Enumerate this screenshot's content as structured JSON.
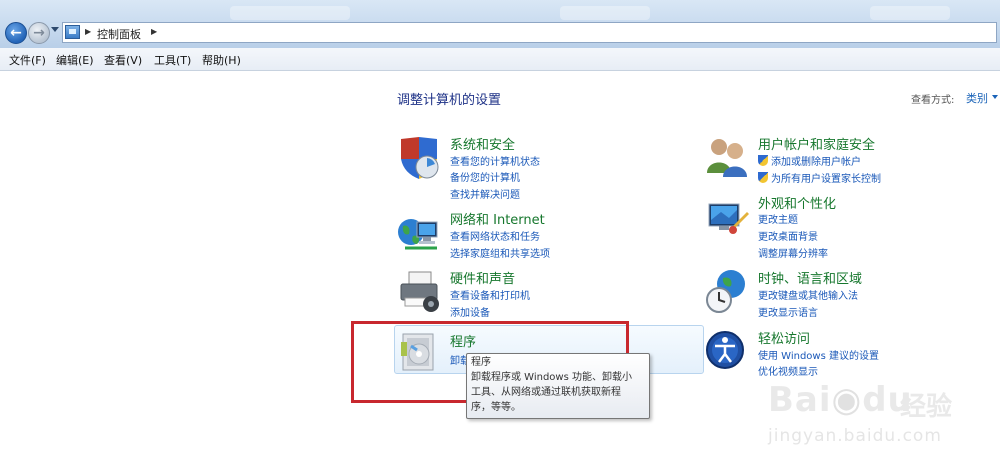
{
  "window": {
    "breadcrumb": [
      "控制面板"
    ]
  },
  "menu": [
    "文件(F)",
    "编辑(E)",
    "查看(V)",
    "工具(T)",
    "帮助(H)"
  ],
  "header": {
    "title": "调整计算机的设置",
    "view_by_label": "查看方式:",
    "view_by_value": "类别"
  },
  "categories": [
    {
      "title": "系统和安全",
      "icon": "system-security-icon",
      "links": [
        "查看您的计算机状态",
        "备份您的计算机",
        "查找并解决问题"
      ]
    },
    {
      "title": "网络和 Internet",
      "icon": "network-internet-icon",
      "links": [
        "查看网络状态和任务",
        "选择家庭组和共享选项"
      ]
    },
    {
      "title": "硬件和声音",
      "icon": "hardware-sound-icon",
      "links": [
        "查看设备和打印机",
        "添加设备"
      ]
    },
    {
      "title": "程序",
      "icon": "programs-icon",
      "links": [
        "卸载程序"
      ]
    },
    {
      "title": "用户帐户和家庭安全",
      "icon": "user-accounts-icon",
      "links": [
        "添加或删除用户帐户",
        "为所有用户设置家长控制"
      ]
    },
    {
      "title": "外观和个性化",
      "icon": "appearance-icon",
      "links": [
        "更改主题",
        "更改桌面背景",
        "调整屏幕分辨率"
      ]
    },
    {
      "title": "时钟、语言和区域",
      "icon": "clock-language-icon",
      "links": [
        "更改键盘或其他输入法",
        "更改显示语言"
      ]
    },
    {
      "title": "轻松访问",
      "icon": "ease-of-access-icon",
      "links": [
        "使用 Windows 建议的设置",
        "优化视频显示"
      ]
    }
  ],
  "tooltip": {
    "title": "程序",
    "lines": [
      "卸载程序或 Windows 功能、卸载小",
      "工具、从网络或通过联机获取新程",
      "序，等等。"
    ]
  },
  "watermark": {
    "logo": "Bai",
    "logo2": "du",
    "cn": "经验",
    "url": "jingyan.baidu.com"
  },
  "colors": {
    "category_title": "#16772d",
    "link": "#1a58b8",
    "page_title": "#1e3287",
    "highlight_border": "#c8282e"
  }
}
